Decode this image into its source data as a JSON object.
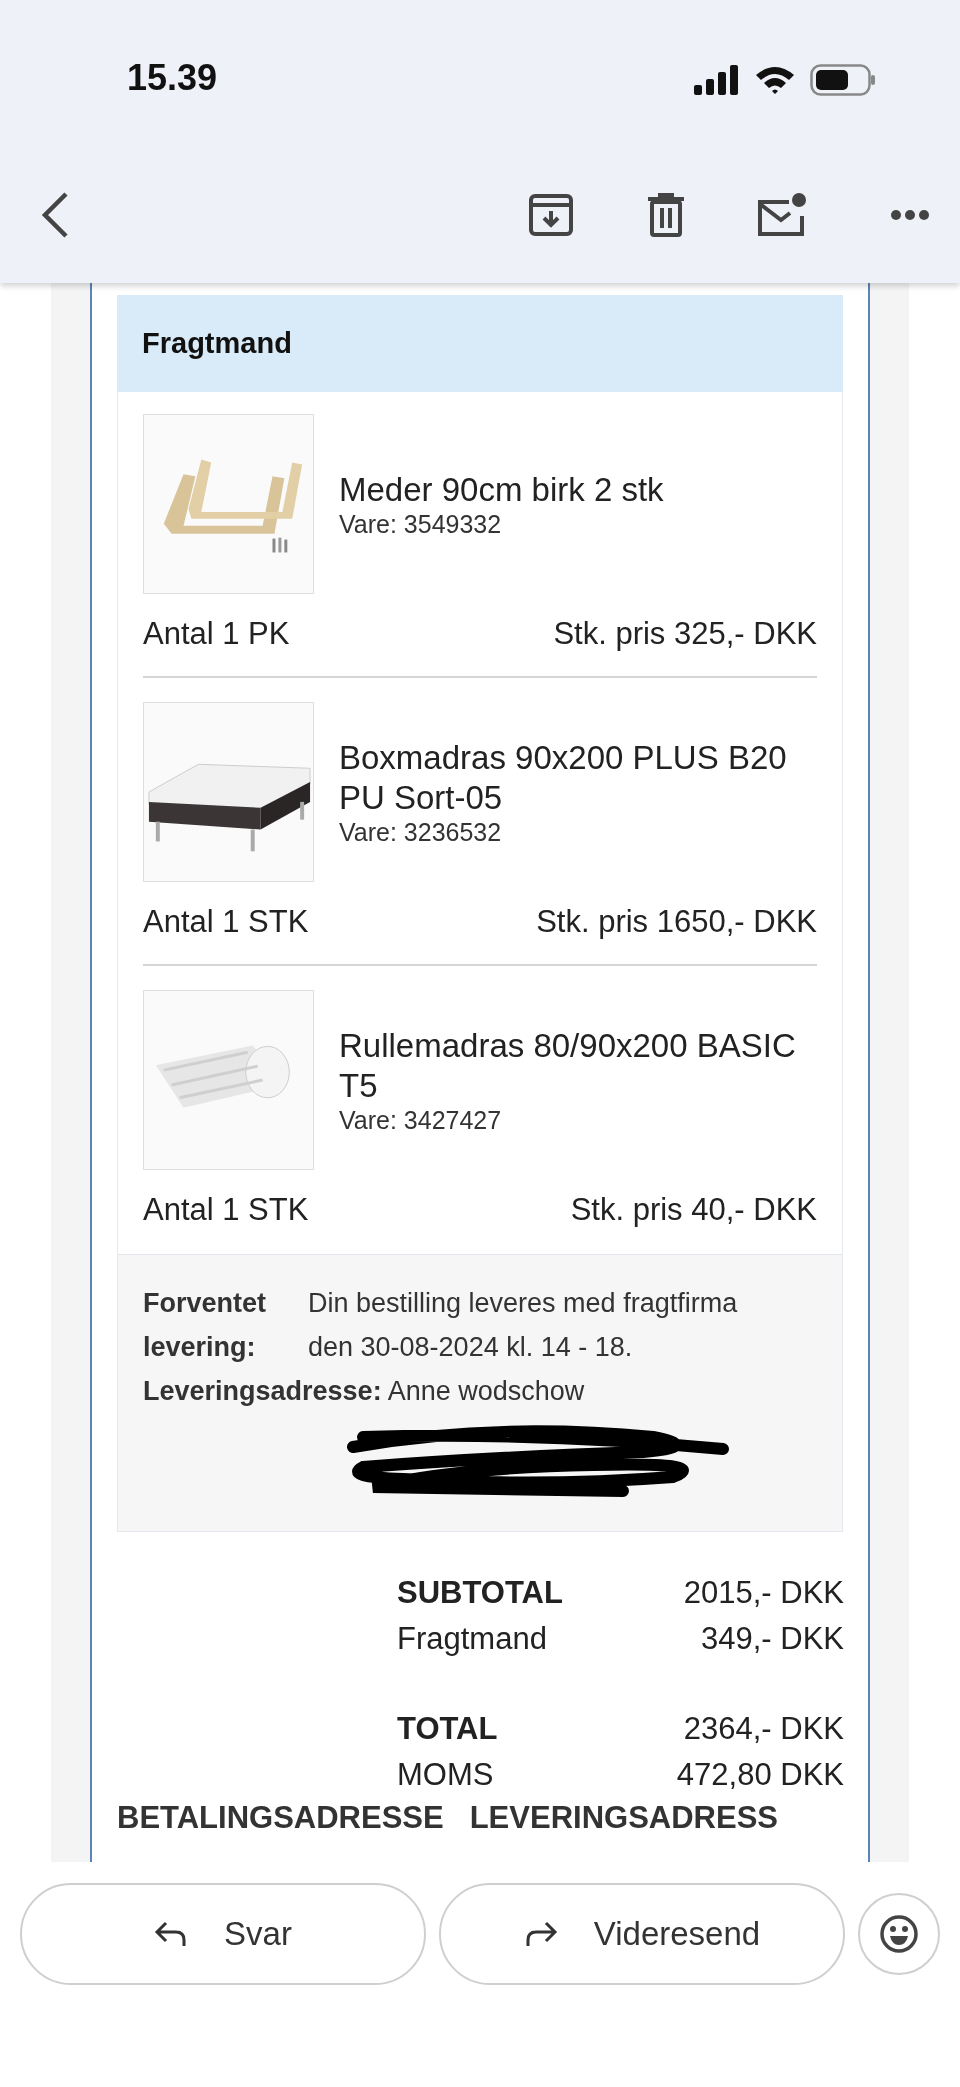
{
  "status_bar": {
    "time": "15.39"
  },
  "order": {
    "section_title": "Fragtmand",
    "items": [
      {
        "name": "Meder 90cm birk 2 stk",
        "sku": "Vare: 3549332",
        "quantity": "Antal 1 PK",
        "unit_price": "Stk. pris 325,- DKK"
      },
      {
        "name": "Boxmadras 90x200 PLUS B20 PU Sort-05",
        "sku": "Vare: 3236532",
        "quantity": "Antal 1 STK",
        "unit_price": "Stk. pris 1650,- DKK"
      },
      {
        "name": "Rullemadras 80/90x200 BASIC T5",
        "sku": "Vare: 3427427",
        "quantity": "Antal 1 STK",
        "unit_price": "Stk. pris 40,- DKK"
      }
    ],
    "delivery": {
      "expected_label": "Forventet levering:",
      "expected_text": "Din bestilling leveres med fragtfirma den 30-08-2024 kl. 14 - 18.",
      "address_label": "Leveringsadresse:",
      "address_name": "Anne wodschow"
    },
    "subtotal_rows": [
      {
        "label": "SUBTOTAL",
        "value": "2015,- DKK",
        "bold": true
      },
      {
        "label": "Fragtmand",
        "value": "349,- DKK",
        "bold": false
      }
    ],
    "total_rows": [
      {
        "label": "TOTAL",
        "value": "2364,- DKK",
        "bold": true
      },
      {
        "label": "MOMS",
        "value": "472,80 DKK",
        "bold": false
      }
    ],
    "address_headings": [
      "BETALINGSADRESSE",
      "LEVERINGSADRESS"
    ]
  },
  "actions": [
    {
      "label": "Svar",
      "kind": "reply"
    },
    {
      "label": "Videresend",
      "kind": "forward"
    }
  ]
}
